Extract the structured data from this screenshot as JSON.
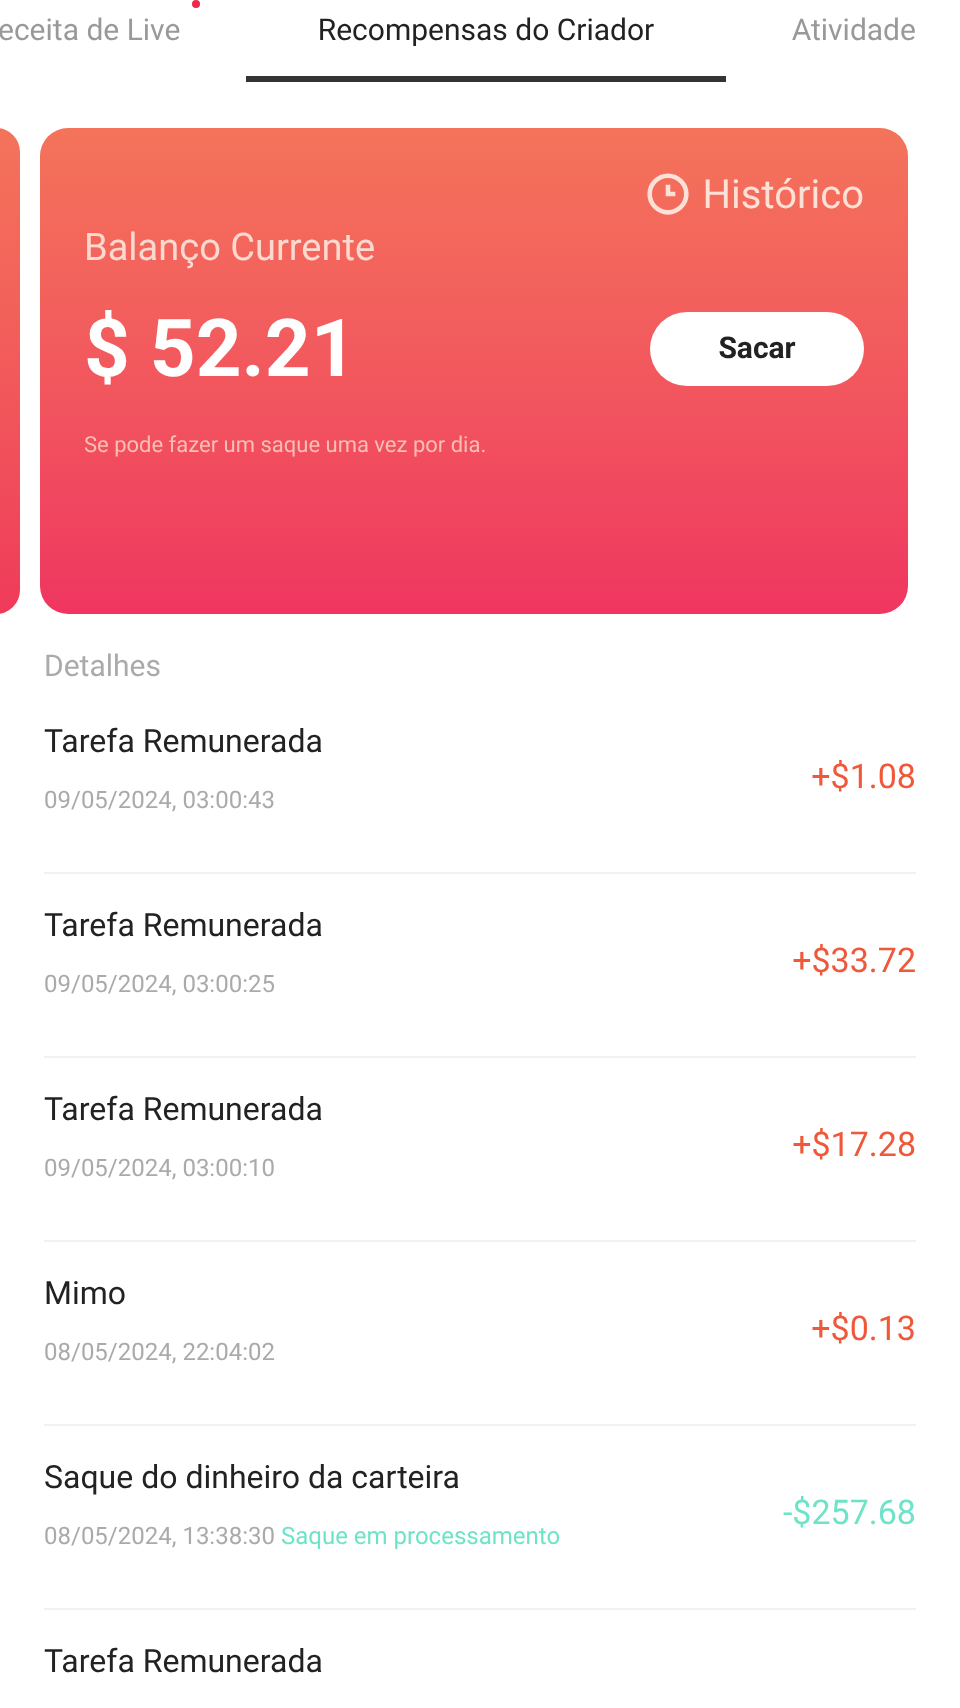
{
  "tabs": [
    {
      "label": "eceita de Live",
      "selected": false,
      "badge": true
    },
    {
      "label": "Recompensas do Criador",
      "selected": true,
      "badge": false
    },
    {
      "label": "Atividade",
      "selected": false,
      "badge": false
    }
  ],
  "balance_card": {
    "history_link": "Histórico",
    "label": "Balanço Currente",
    "amount": "$ 52.21",
    "button": "Sacar",
    "note": "Se pode fazer um saque uma vez por dia."
  },
  "details": {
    "heading": "Detalhes",
    "items": [
      {
        "title": "Tarefa Remunerada",
        "time": "09/05/2024, 03:00:43",
        "amount": "+$1.08",
        "kind": "credit"
      },
      {
        "title": "Tarefa Remunerada",
        "time": "09/05/2024, 03:00:25",
        "amount": "+$33.72",
        "kind": "credit"
      },
      {
        "title": "Tarefa Remunerada",
        "time": "09/05/2024, 03:00:10",
        "amount": "+$17.28",
        "kind": "credit"
      },
      {
        "title": "Mimo",
        "time": "08/05/2024, 22:04:02",
        "amount": "+$0.13",
        "kind": "credit"
      },
      {
        "title": "Saque do dinheiro da carteira",
        "time": "08/05/2024, 13:38:30",
        "status": "Saque em processamento",
        "amount": "-$257.68",
        "kind": "debit"
      },
      {
        "title": "Tarefa Remunerada"
      }
    ]
  }
}
